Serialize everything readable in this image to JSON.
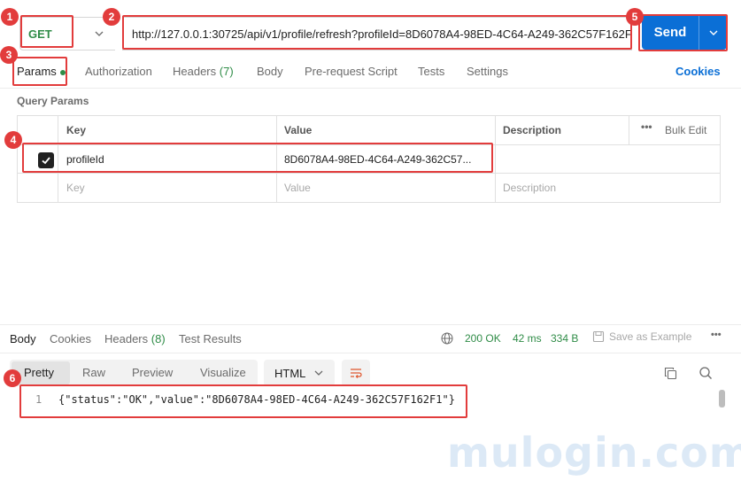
{
  "request": {
    "method": "GET",
    "url": "http://127.0.0.1:30725/api/v1/profile/refresh?profileId=8D6078A4-98ED-4C64-A249-362C57F162F",
    "send_label": "Send"
  },
  "tabs": {
    "params": "Params",
    "authorization": "Authorization",
    "headers": "Headers",
    "headers_count": "(7)",
    "body": "Body",
    "pre_request": "Pre-request Script",
    "tests": "Tests",
    "settings": "Settings",
    "cookies": "Cookies"
  },
  "query_params": {
    "title": "Query Params",
    "columns": {
      "key": "Key",
      "value": "Value",
      "description": "Description",
      "bulk_edit": "Bulk Edit"
    },
    "rows": [
      {
        "checked": true,
        "key": "profileId",
        "value": "8D6078A4-98ED-4C64-A249-362C57...",
        "description": ""
      }
    ],
    "placeholders": {
      "key": "Key",
      "value": "Value",
      "description": "Description"
    }
  },
  "response": {
    "tabs": {
      "body": "Body",
      "cookies": "Cookies",
      "headers": "Headers",
      "headers_count": "(8)",
      "test_results": "Test Results"
    },
    "status": "200 OK",
    "time": "42 ms",
    "size": "334 B",
    "save_label": "Save as Example",
    "views": {
      "pretty": "Pretty",
      "raw": "Raw",
      "preview": "Preview",
      "visualize": "Visualize"
    },
    "format": "HTML",
    "line_number": "1",
    "body_text": "{\"status\":\"OK\",\"value\":\"8D6078A4-98ED-4C64-A249-362C57F162F1\"}"
  },
  "markers": [
    "1",
    "2",
    "3",
    "4",
    "5",
    "6"
  ],
  "watermark": "mulogin.com",
  "colors": {
    "accent": "#0b6fd6",
    "method_green": "#2f8c47",
    "annotation_red": "#e23c3c"
  }
}
